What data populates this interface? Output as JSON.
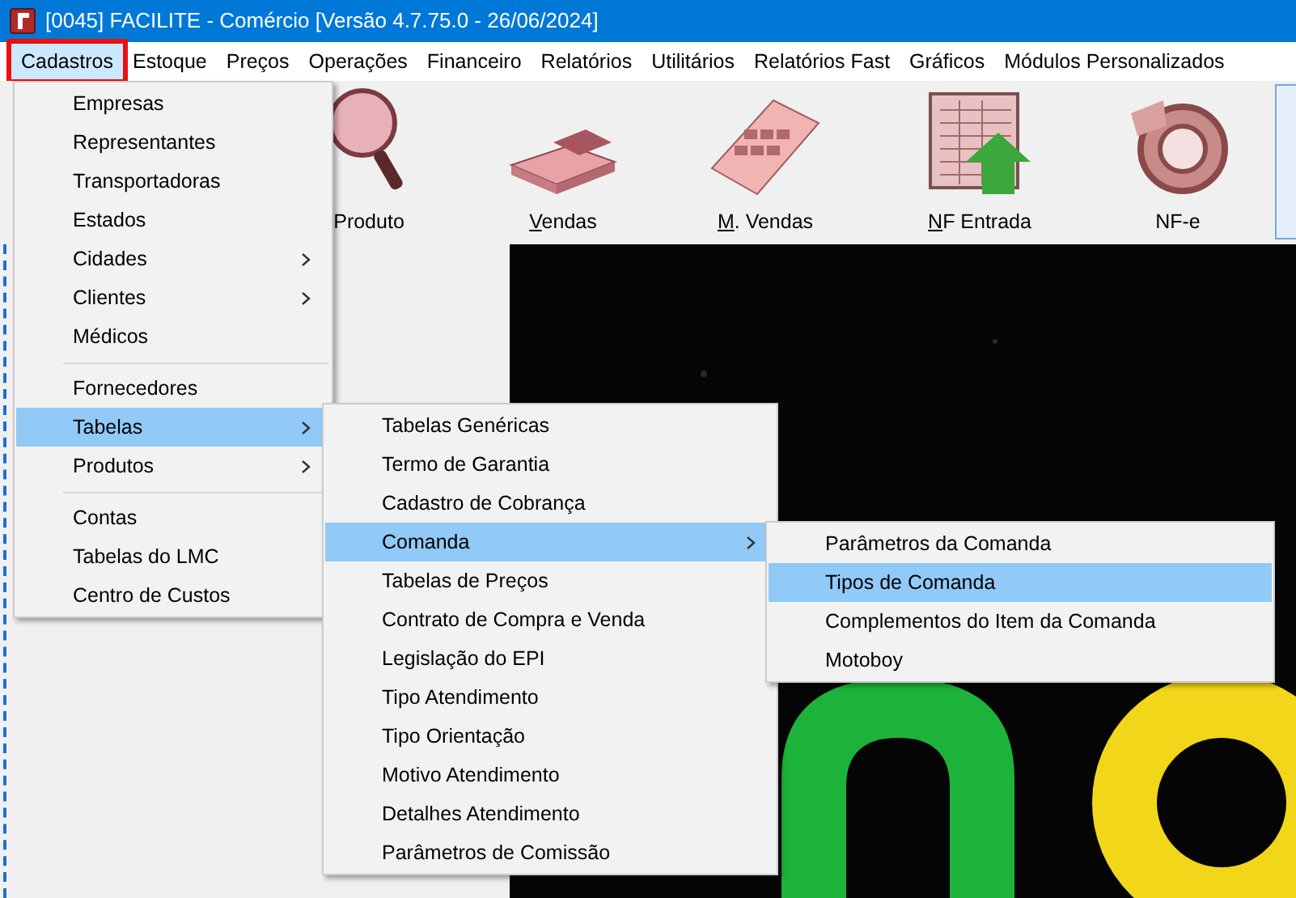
{
  "window": {
    "title": "[0045] FACILITE - Comércio [Versão 4.7.75.0 - 26/06/2024]"
  },
  "menu_bar": [
    {
      "label": "Cadastros",
      "selected": true,
      "annotated": true
    },
    {
      "label": "Estoque",
      "selected": false,
      "annotated": false
    },
    {
      "label": "Preços",
      "selected": false,
      "annotated": false
    },
    {
      "label": "Operações",
      "selected": false,
      "annotated": false
    },
    {
      "label": "Financeiro",
      "selected": false,
      "annotated": false
    },
    {
      "label": "Relatórios",
      "selected": false,
      "annotated": false
    },
    {
      "label": "Utilitários",
      "selected": false,
      "annotated": false
    },
    {
      "label": "Relatórios Fast",
      "selected": false,
      "annotated": false
    },
    {
      "label": "Gráficos",
      "selected": false,
      "annotated": false
    },
    {
      "label": "Módulos Personalizados",
      "selected": false,
      "annotated": false
    }
  ],
  "toolbar": [
    {
      "label": "Produto",
      "kind": "magnifier",
      "underline_first": false
    },
    {
      "label": "Vendas",
      "kind": "money",
      "underline_first": true
    },
    {
      "label": "M. Vendas",
      "kind": "calculator",
      "underline_first": true
    },
    {
      "label": "NF Entrada",
      "kind": "sheet",
      "underline_first": true
    },
    {
      "label": "NF-e",
      "kind": "emblem",
      "underline_first": false
    }
  ],
  "menus": [
    {
      "items": [
        {
          "kind": "item",
          "label": "Empresas",
          "submenu": false,
          "selected": false
        },
        {
          "kind": "item",
          "label": "Representantes",
          "submenu": false,
          "selected": false
        },
        {
          "kind": "item",
          "label": "Transportadoras",
          "submenu": false,
          "selected": false
        },
        {
          "kind": "item",
          "label": "Estados",
          "submenu": false,
          "selected": false
        },
        {
          "kind": "item",
          "label": "Cidades",
          "submenu": true,
          "selected": false
        },
        {
          "kind": "item",
          "label": "Clientes",
          "submenu": true,
          "selected": false
        },
        {
          "kind": "item",
          "label": "Médicos",
          "submenu": false,
          "selected": false
        },
        {
          "kind": "separator"
        },
        {
          "kind": "item",
          "label": "Fornecedores",
          "submenu": false,
          "selected": false
        },
        {
          "kind": "item",
          "label": "Tabelas",
          "submenu": true,
          "selected": true
        },
        {
          "kind": "item",
          "label": "Produtos",
          "submenu": true,
          "selected": false
        },
        {
          "kind": "separator"
        },
        {
          "kind": "item",
          "label": "Contas",
          "submenu": false,
          "selected": false
        },
        {
          "kind": "item",
          "label": "Tabelas do LMC",
          "submenu": false,
          "selected": false
        },
        {
          "kind": "item",
          "label": "Centro de Custos",
          "submenu": false,
          "selected": false
        }
      ]
    },
    {
      "items": [
        {
          "kind": "item",
          "label": "Tabelas Genéricas",
          "submenu": false,
          "selected": false
        },
        {
          "kind": "item",
          "label": "Termo de Garantia",
          "submenu": false,
          "selected": false
        },
        {
          "kind": "item",
          "label": "Cadastro de Cobrança",
          "submenu": false,
          "selected": false
        },
        {
          "kind": "item",
          "label": "Comanda",
          "submenu": true,
          "selected": true
        },
        {
          "kind": "item",
          "label": "Tabelas de Preços",
          "submenu": false,
          "selected": false
        },
        {
          "kind": "item",
          "label": "Contrato de Compra e Venda",
          "submenu": false,
          "selected": false
        },
        {
          "kind": "item",
          "label": "Legislação do EPI",
          "submenu": false,
          "selected": false
        },
        {
          "kind": "item",
          "label": "Tipo Atendimento",
          "submenu": false,
          "selected": false
        },
        {
          "kind": "item",
          "label": "Tipo Orientação",
          "submenu": false,
          "selected": false
        },
        {
          "kind": "item",
          "label": "Motivo Atendimento",
          "submenu": false,
          "selected": false
        },
        {
          "kind": "item",
          "label": "Detalhes Atendimento",
          "submenu": false,
          "selected": false
        },
        {
          "kind": "item",
          "label": "Parâmetros de Comissão",
          "submenu": false,
          "selected": false
        }
      ]
    },
    {
      "items": [
        {
          "kind": "item",
          "label": "Parâmetros da Comanda",
          "submenu": false,
          "selected": false
        },
        {
          "kind": "item",
          "label": "Tipos de Comanda",
          "submenu": false,
          "selected": true
        },
        {
          "kind": "item",
          "label": "Complementos do Item da Comanda",
          "submenu": false,
          "selected": false
        },
        {
          "kind": "item",
          "label": "Motoboy",
          "submenu": false,
          "selected": false
        }
      ]
    }
  ]
}
